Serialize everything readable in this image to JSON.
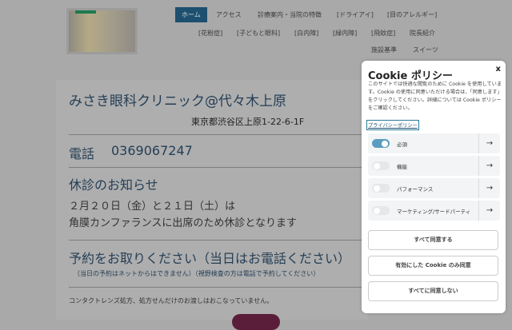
{
  "nav": {
    "row1": [
      "ホーム",
      "アクセス",
      "診療案内・当院の特徴",
      "[ドライアイ]",
      "[目のアレルギー]"
    ],
    "row2": [
      "[花粉症]",
      "[子どもと眼科]",
      "[白内障]",
      "[緑内障]",
      "[飛蚊症]",
      "院長紹介"
    ],
    "row3": [
      "施設基準",
      "スイーツ"
    ]
  },
  "main": {
    "clinic_name": "みさき眼科クリニック@代々木上原",
    "address": "東京都渋谷区上原1-22-6-1F",
    "tel_label": "電話",
    "tel": "0369067247",
    "notice_title": "休診のお知らせ",
    "notice_line1": "２月２０日（金）と２１日（土）は",
    "notice_line2": "角膜カンファランスに出席のため休診となります",
    "reserve_title": "予約をお取りください（当日はお電話ください）",
    "reserve_note": "（当日の予約はネットからはできません）（視野検査の方は電話で予約してください）",
    "contact_note": "コンタクトレンズ処方、処方せんだけのお渡しはおこなっていません。"
  },
  "cookie": {
    "title": "Cookie ポリシー",
    "close": "x",
    "description": "このサイトでは快適な閲覧のために Cookie を使用しています。Cookie の使用に同意いただける場合は、「同意します」をクリックしてください。詳細については Cookie ポリシーをご確認ください。",
    "privacy_link": "プライバシーポリシー",
    "categories": [
      {
        "label": "必須",
        "enabled": true
      },
      {
        "label": "機能",
        "enabled": false
      },
      {
        "label": "パフォーマンス",
        "enabled": false
      },
      {
        "label": "マーケティング/サードパーティ",
        "enabled": false
      }
    ],
    "arrow": "→",
    "accept_all": "すべて同意する",
    "accept_selected": "有効にした Cookie のみ同意",
    "reject_all": "すべてに同意しない"
  }
}
